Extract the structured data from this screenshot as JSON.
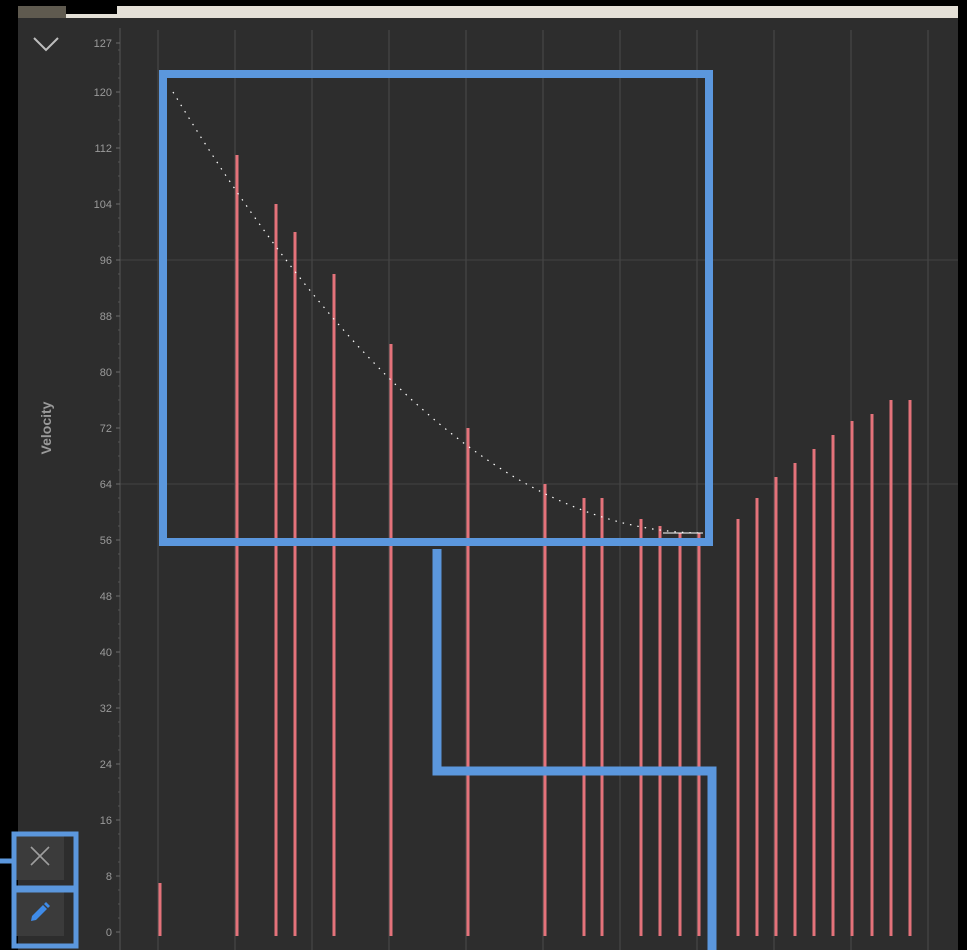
{
  "lane": {
    "title": "Velocity",
    "icons": {
      "collapse": "chevron-down-icon",
      "clear": "close-icon",
      "draw": "pencil-icon"
    },
    "colors": {
      "bar": "#e4727a",
      "highlight": "#5b97dd",
      "curve": "#ffffff",
      "grid": "#4a4a4a",
      "background": "#2d2d2d"
    }
  },
  "chart_data": {
    "type": "bar",
    "title": "",
    "ylabel": "Velocity",
    "ylim": [
      0,
      127
    ],
    "yticks": [
      0,
      8,
      16,
      24,
      32,
      40,
      48,
      56,
      64,
      72,
      80,
      88,
      96,
      104,
      112,
      120,
      127
    ],
    "grid": true,
    "series": [
      {
        "values": [
          7,
          111,
          104,
          100,
          94,
          84,
          72,
          64,
          62,
          62,
          59,
          58,
          57,
          57,
          59,
          62,
          65,
          67,
          69,
          71,
          73,
          74,
          76,
          76
        ]
      }
    ],
    "ramp_curve": [
      120,
      57
    ]
  }
}
